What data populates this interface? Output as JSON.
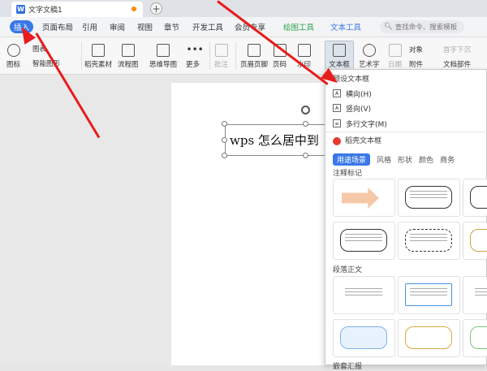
{
  "titlebar": {
    "doc_tab": "文字文稿1",
    "new_tab": "+"
  },
  "menubar": {
    "items": [
      "插入",
      "页面布局",
      "引用",
      "审阅",
      "视图",
      "章节",
      "开发工具",
      "会员专享",
      "绘图工具",
      "文本工具"
    ],
    "search_placeholder": "查找命令、搜索模板"
  },
  "toolbar": {
    "shapes": "图标",
    "chart": "图表",
    "smartart": "智能图形",
    "shell": "稻壳素材",
    "flowchart": "流程图",
    "mindmap": "思维导图",
    "more": "更多",
    "comment": "批注",
    "header": "页眉页脚",
    "pagenum": "页码",
    "watermark": "水印",
    "textbox": "文本框",
    "arttext": "艺术字",
    "date": "日期",
    "object": "对象",
    "attachment": "附件",
    "initial": "首字下沉",
    "docparts": "文档部件"
  },
  "document": {
    "textbox_text": "wps 怎么居中到"
  },
  "dropdown": {
    "preset_title": "预设文本框",
    "horizontal": "横向(H)",
    "vertical": "竖向(V)",
    "multiline": "多行文字(M)",
    "shell_title": "稻壳文本框",
    "categories": [
      "用途场景",
      "风格",
      "形状",
      "颜色",
      "商务"
    ],
    "section1": "注释标记",
    "section2": "段落正文",
    "section3": "嵌套汇报"
  },
  "colors": {
    "accent": "#3b78e7",
    "arrow": "#e81c1c"
  }
}
